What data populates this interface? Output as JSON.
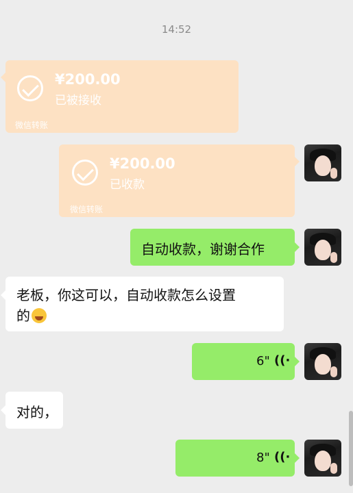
{
  "chat": {
    "timestamp": "14:52",
    "transfer_received": {
      "amount": "¥200.00",
      "status": "已被接收",
      "footer": "微信转账"
    },
    "transfer_collected": {
      "amount": "¥200.00",
      "status": "已收款",
      "footer": "微信转账"
    },
    "messages": [
      {
        "side": "right",
        "text": "自动收款，谢谢合作"
      },
      {
        "side": "left",
        "text_line1": "老板，你这可以，自动收款怎么设置",
        "text_line2": "的"
      },
      {
        "side": "right",
        "voice_duration": "6\""
      },
      {
        "side": "left",
        "text": "对的，"
      },
      {
        "side": "right",
        "voice_duration": "8\""
      }
    ],
    "colors": {
      "background": "#ededed",
      "outgoing_bubble": "#95ec69",
      "incoming_bubble": "#ffffff",
      "transfer_card": "#fde1c3"
    },
    "icons": {
      "voice": "voice-wave-icon",
      "check": "check-circle-icon",
      "emoji": "laughing-tears-emoji-icon"
    }
  }
}
